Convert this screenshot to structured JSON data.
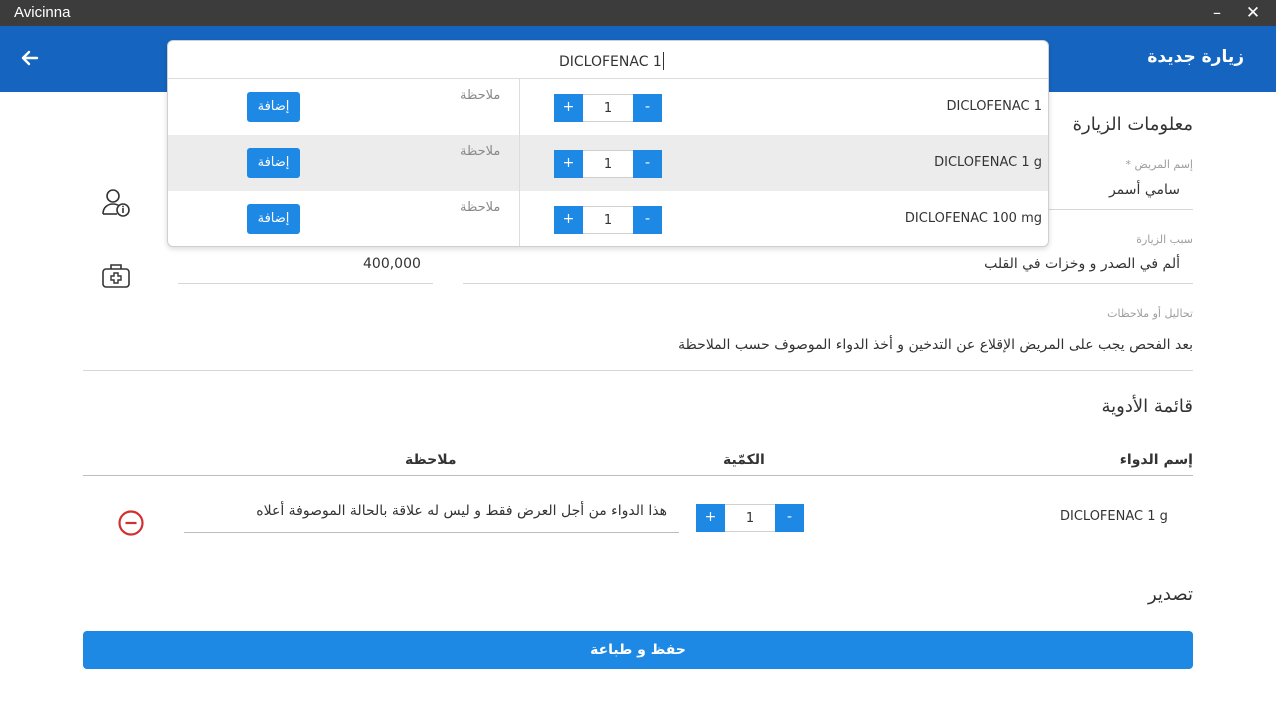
{
  "window": {
    "title": "Avicinna",
    "minimize_label": "–",
    "close_label": "✕"
  },
  "header": {
    "title": "زيارة جديدة",
    "back_icon": "arrow-left-icon",
    "background": "#1565c0"
  },
  "visit_info": {
    "section_title": "معلومات الزيارة",
    "patient_name_label": "إسم المريض *",
    "patient_name": "سامي أسمر",
    "reason_label": "سبب الزيارة",
    "reason": "ألم في الصدر و وخزات في القلب",
    "fee": "400,000",
    "notes_label": "تحاليل أو ملاحظات",
    "notes": "بعد الفحص يجب على المريض الإقلاع عن التدخين و أخذ الدواء الموصوف حسب الملاحظة"
  },
  "search": {
    "query": "DICLOFENAC 1",
    "results": [
      {
        "name": "DICLOFENAC 1",
        "quantity": "1",
        "note_label": "ملاحظة",
        "add_label": "إضافة",
        "plus": "+",
        "minus": "-"
      },
      {
        "name": "DICLOFENAC 1 g",
        "quantity": "1",
        "note_label": "ملاحظة",
        "add_label": "إضافة",
        "plus": "+",
        "minus": "-"
      },
      {
        "name": "DICLOFENAC 100 mg",
        "quantity": "1",
        "note_label": "ملاحظة",
        "add_label": "إضافة",
        "plus": "+",
        "minus": "-"
      }
    ]
  },
  "medicines": {
    "section_title": "قائمة الأدوية",
    "columns": {
      "name": "إسم الدواء",
      "quantity": "الكمّية",
      "note": "ملاحظة"
    },
    "rows": [
      {
        "name": "DICLOFENAC 1 g",
        "quantity": "1",
        "plus": "+",
        "minus": "-",
        "note": "هذا الدواء من أجل العرض فقط و ليس له علاقة بالحالة الموصوفة أعلاه"
      }
    ]
  },
  "export": {
    "section_title": "تصدير",
    "save_print_label": "حفظ و طباعة"
  },
  "colors": {
    "accent": "#1e88e5",
    "remove": "#d32f2f"
  }
}
